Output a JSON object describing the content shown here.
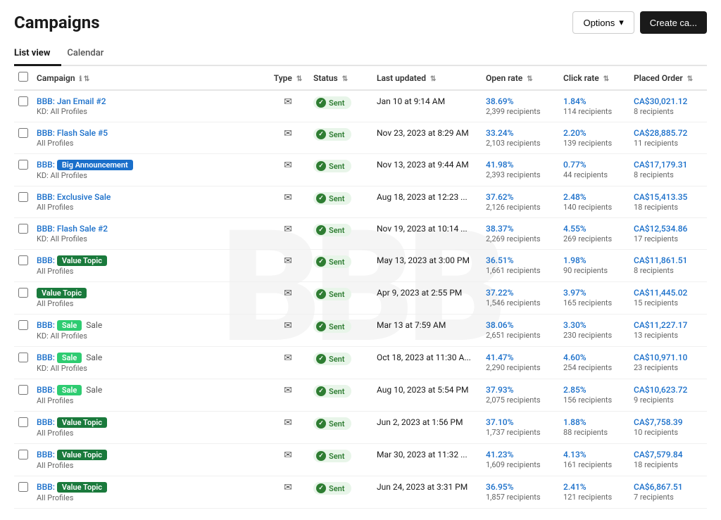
{
  "page": {
    "title": "Campaigns",
    "tabs": [
      {
        "label": "List view",
        "active": true
      },
      {
        "label": "Calendar",
        "active": false
      }
    ],
    "buttons": {
      "options": "Options",
      "create": "Create ca..."
    }
  },
  "table": {
    "headers": {
      "campaign": "Campaign",
      "type": "Type",
      "status": "Status",
      "last_updated": "Last updated",
      "open_rate": "Open rate",
      "click_rate": "Click rate",
      "placed_order": "Placed Order"
    },
    "rows": [
      {
        "name": "BBB: Jan Email #2",
        "sub": "KD: All Profiles",
        "tags": [],
        "highlight": null,
        "type": "email",
        "status": "Sent",
        "updated": "Jan 10 at 9:14 AM",
        "open_rate": "38.69%",
        "open_recipients": "2,399 recipients",
        "click_rate": "1.84%",
        "click_recipients": "114 recipients",
        "placed_order": "CA$30,021.12",
        "placed_recipients": "8 recipients"
      },
      {
        "name": "BBB: Flash Sale #5",
        "sub": "All Profiles",
        "tags": [],
        "highlight": null,
        "type": "email",
        "status": "Sent",
        "updated": "Nov 23, 2023 at 8:29 AM",
        "open_rate": "33.24%",
        "open_recipients": "2,103 recipients",
        "click_rate": "2.20%",
        "click_recipients": "139 recipients",
        "placed_order": "CA$28,885.72",
        "placed_recipients": "11 recipients"
      },
      {
        "name_prefix": "BBB:",
        "name_tag": "Big Announcement",
        "name_tag_color": "tag-blue",
        "sub": "KD: All Profiles",
        "type": "email",
        "status": "Sent",
        "updated": "Nov 13, 2023 at 9:44 AM",
        "open_rate": "41.98%",
        "open_recipients": "2,393 recipients",
        "click_rate": "0.77%",
        "click_recipients": "44 recipients",
        "placed_order": "CA$17,179.31",
        "placed_recipients": "8 recipients"
      },
      {
        "name": "BBB: Exclusive Sale",
        "sub": "All Profiles",
        "tags": [],
        "type": "email",
        "status": "Sent",
        "updated": "Aug 18, 2023 at 12:23 ...",
        "open_rate": "37.62%",
        "open_recipients": "2,126 recipients",
        "click_rate": "2.48%",
        "click_recipients": "140 recipients",
        "placed_order": "CA$15,413.35",
        "placed_recipients": "18 recipients"
      },
      {
        "name": "BBB: Flash Sale #2",
        "sub": "KD: All Profiles",
        "tags": [],
        "type": "email",
        "status": "Sent",
        "updated": "Nov 19, 2023 at 10:14 ...",
        "open_rate": "38.37%",
        "open_recipients": "2,269 recipients",
        "click_rate": "4.55%",
        "click_recipients": "269 recipients",
        "placed_order": "CA$12,534.86",
        "placed_recipients": "17 recipients"
      },
      {
        "name_prefix": "BBB:",
        "name_tag": "Value Topic",
        "name_tag_color": "tag-green-dark",
        "sub": "All Profiles",
        "type": "email",
        "status": "Sent",
        "updated": "May 13, 2023 at 3:00 PM",
        "open_rate": "36.51%",
        "open_recipients": "1,661 recipients",
        "click_rate": "1.98%",
        "click_recipients": "90 recipients",
        "placed_order": "CA$11,861.51",
        "placed_recipients": "8 recipients"
      },
      {
        "name_tag_only": "Value Topic",
        "name_tag_color": "tag-green-dark",
        "sub": "All Profiles",
        "type": "email",
        "status": "Sent",
        "updated": "Apr 9, 2023 at 2:55 PM",
        "open_rate": "37.22%",
        "open_recipients": "1,546 recipients",
        "click_rate": "3.97%",
        "click_recipients": "165 recipients",
        "placed_order": "CA$11,445.02",
        "placed_recipients": "15 recipients"
      },
      {
        "name_prefix": "BBB:",
        "name_tag": "Sale",
        "name_tag_color": "tag-green",
        "name_suffix": "Sale",
        "sub": "KD: All Profiles",
        "type": "email",
        "status": "Sent",
        "updated": "Mar 13 at 7:59 AM",
        "open_rate": "38.06%",
        "open_recipients": "2,651 recipients",
        "click_rate": "3.30%",
        "click_recipients": "230 recipients",
        "placed_order": "CA$11,227.17",
        "placed_recipients": "13 recipients"
      },
      {
        "name_prefix": "BBB:",
        "name_tag": "Sale",
        "name_tag_color": "tag-green",
        "name_suffix": "Sale",
        "sub": "KD: All Profiles",
        "type": "email",
        "status": "Sent",
        "updated": "Oct 18, 2023 at 11:30 A...",
        "open_rate": "41.47%",
        "open_recipients": "2,290 recipients",
        "click_rate": "4.60%",
        "click_recipients": "254 recipients",
        "placed_order": "CA$10,971.10",
        "placed_recipients": "23 recipients"
      },
      {
        "name_prefix": "BBB:",
        "name_tag": "Sale",
        "name_tag_color": "tag-green",
        "name_suffix": "Sale",
        "sub": "All Profiles",
        "type": "email",
        "status": "Sent",
        "updated": "Aug 10, 2023 at 5:54 PM",
        "open_rate": "37.93%",
        "open_recipients": "2,075 recipients",
        "click_rate": "2.85%",
        "click_recipients": "156 recipients",
        "placed_order": "CA$10,623.72",
        "placed_recipients": "9 recipients"
      },
      {
        "name_prefix": "BBB:",
        "name_tag": "Value Topic",
        "name_tag_color": "tag-green-dark",
        "sub": "All Profiles",
        "type": "email",
        "status": "Sent",
        "updated": "Jun 2, 2023 at 1:56 PM",
        "open_rate": "37.10%",
        "open_recipients": "1,737 recipients",
        "click_rate": "1.88%",
        "click_recipients": "88 recipients",
        "placed_order": "CA$7,758.39",
        "placed_recipients": "10 recipients"
      },
      {
        "name_prefix": "BBB:",
        "name_tag": "Value Topic",
        "name_tag_color": "tag-green-dark",
        "sub": "All Profiles",
        "type": "email",
        "status": "Sent",
        "updated": "Mar 30, 2023 at 11:32 ...",
        "open_rate": "41.23%",
        "open_recipients": "1,609 recipients",
        "click_rate": "4.13%",
        "click_recipients": "161 recipients",
        "placed_order": "CA$7,579.84",
        "placed_recipients": "18 recipients"
      },
      {
        "name_prefix": "BBB:",
        "name_tag": "Value Topic",
        "name_tag_color": "tag-green-dark",
        "sub": "All Profiles",
        "type": "email",
        "status": "Sent",
        "updated": "Jun 24, 2023 at 3:31 PM",
        "open_rate": "36.95%",
        "open_recipients": "1,857 recipients",
        "click_rate": "2.41%",
        "click_recipients": "121 recipients",
        "placed_order": "CA$6,867.51",
        "placed_recipients": "7 recipients"
      }
    ]
  },
  "watermark": "BBB"
}
